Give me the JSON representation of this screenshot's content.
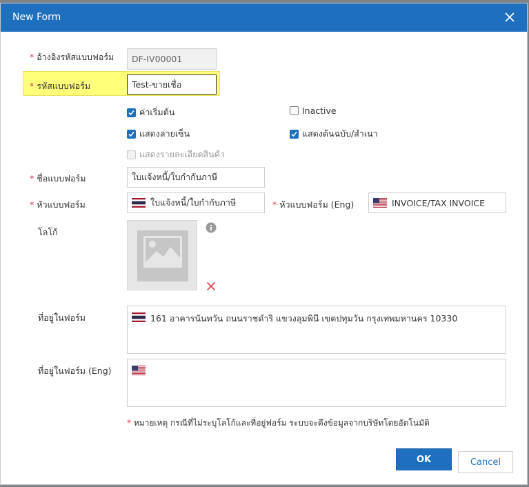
{
  "dialog": {
    "title": "New Form"
  },
  "fields": {
    "ref_code": {
      "label": "อ้างอิงรหัสแบบฟอร์ม",
      "value": "DF-IV00001"
    },
    "form_code": {
      "label": "รหัสแบบฟอร์ม",
      "value": "Test-ขายเชื่อ"
    },
    "form_name": {
      "label": "ชื่อแบบฟอร์ม",
      "value": "ใบแจ้งหนี้/ใบกำกับภาษี"
    },
    "header_th": {
      "label": "หัวแบบฟอร์ม",
      "value": "ใบแจ้งหนี้/ใบกำกับภาษี"
    },
    "header_en": {
      "label": "หัวแบบฟอร์ม (Eng)",
      "value": "INVOICE/TAX INVOICE"
    },
    "logo": {
      "label": "โลโก้"
    },
    "address_th": {
      "label": "ที่อยู่ในฟอร์ม",
      "value": "161 อาคารนันทวัน ถนนราชดำริ แขวงลุมพินี เขตปทุมวัน กรุงเทพมหานคร 10330"
    },
    "address_en": {
      "label": "ที่อยู่ในฟอร์ม (Eng)",
      "value": ""
    }
  },
  "required_marker": "*",
  "checkboxes": {
    "default": {
      "label": "ค่าเริ่มต้น",
      "checked": true
    },
    "inactive": {
      "label": "Inactive",
      "checked": false
    },
    "show_signature": {
      "label": "แสดงลายเซ็น",
      "checked": true
    },
    "show_original_copy": {
      "label": "แสดงต้นฉบับ/สำเนา",
      "checked": true
    },
    "show_product_detail": {
      "label": "แสดงรายละเอียดสินค้า",
      "checked": false,
      "disabled": true
    }
  },
  "note": "หมายเหตุ กรณีที่ไม่ระบุโลโก้และที่อยู่ฟอร์ม ระบบจะดึงข้อมูลจากบริษัทโดยอัตโนมัติ",
  "buttons": {
    "ok": "OK",
    "cancel": "Cancel"
  },
  "colors": {
    "primary": "#1f6fbf",
    "required": "#d9364a",
    "highlight": "#ffff7a",
    "remove": "#e0474c"
  }
}
